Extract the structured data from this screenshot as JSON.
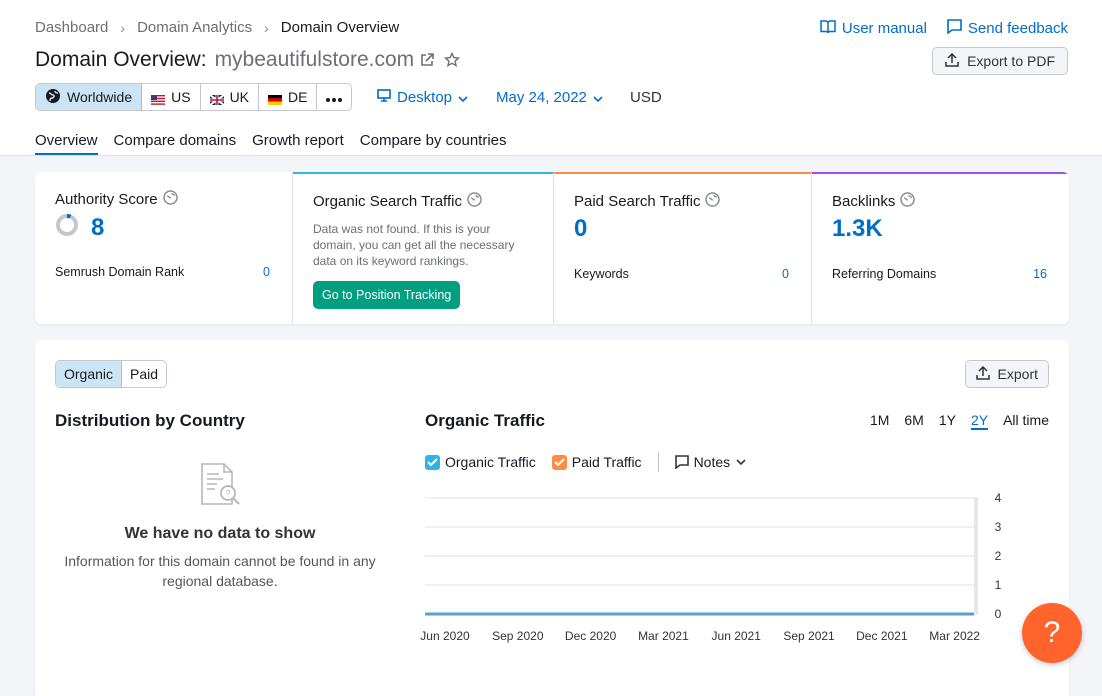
{
  "breadcrumb": [
    "Dashboard",
    "Domain Analytics",
    "Domain Overview"
  ],
  "header": {
    "user_manual": "User manual",
    "send_feedback": "Send feedback",
    "title_label": "Domain Overview:",
    "domain": "mybeautifulstore.com",
    "export_pdf": "Export to PDF"
  },
  "databases": [
    {
      "label": "Worldwide",
      "icon": "globe-icon",
      "active": true
    },
    {
      "label": "US",
      "icon": "us-flag-icon"
    },
    {
      "label": "UK",
      "icon": "uk-flag-icon"
    },
    {
      "label": "DE",
      "icon": "de-flag-icon"
    }
  ],
  "device": "Desktop",
  "date": "May 24, 2022",
  "currency": "USD",
  "tabs": [
    "Overview",
    "Compare domains",
    "Growth report",
    "Compare by countries"
  ],
  "cards": {
    "authority": {
      "title": "Authority Score",
      "value": "8",
      "row_label": "Semrush Domain Rank",
      "row_value": "0"
    },
    "organic": {
      "title": "Organic Search Traffic",
      "desc": "Data was not found. If this is your domain, you can get all the necessary data on its keyword rankings.",
      "button": "Go to Position Tracking"
    },
    "paid": {
      "title": "Paid Search Traffic",
      "value": "0",
      "row_label": "Keywords",
      "row_value": "0"
    },
    "backlinks": {
      "title": "Backlinks",
      "value": "1.3K",
      "row_label": "Referring Domains",
      "row_value": "16"
    }
  },
  "panel": {
    "toggle": [
      "Organic",
      "Paid"
    ],
    "export": "Export",
    "distribution_title": "Distribution by Country",
    "empty_title": "We have no data to show",
    "empty_text": "Information for this domain cannot be found in any regional database.",
    "traffic_title": "Organic Traffic",
    "periods": [
      "1M",
      "6M",
      "1Y",
      "2Y",
      "All time"
    ],
    "active_period": "2Y",
    "legend": {
      "organic": "Organic Traffic",
      "paid": "Paid Traffic",
      "notes": "Notes"
    }
  },
  "colors": {
    "accent": "#006dca",
    "organic": "#2fb4e9",
    "paid": "#ff8c43",
    "green": "#009f81",
    "help": "#ff642d"
  },
  "chart_data": {
    "type": "line",
    "x": [
      "Jun 2020",
      "Sep 2020",
      "Dec 2020",
      "Mar 2021",
      "Jun 2021",
      "Sep 2021",
      "Dec 2021",
      "Mar 2022"
    ],
    "series": [
      {
        "name": "Organic Traffic",
        "values": [
          0,
          0,
          0,
          0,
          0,
          0,
          0,
          0
        ]
      }
    ],
    "yticks": [
      0,
      1,
      2,
      3,
      4
    ],
    "ylim": [
      0,
      4
    ],
    "grid": true
  },
  "help_label": "?"
}
